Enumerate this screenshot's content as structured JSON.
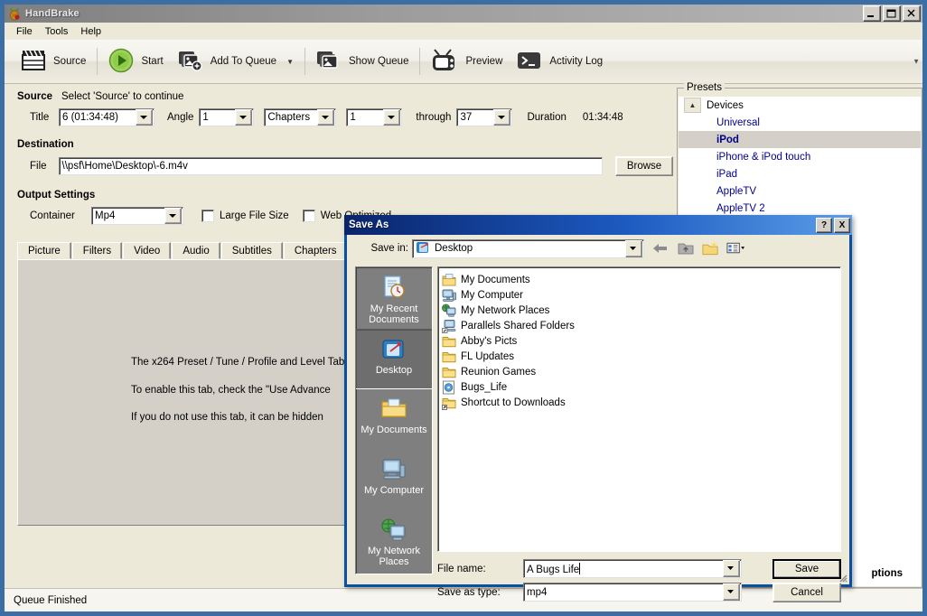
{
  "app": {
    "title": "HandBrake",
    "icon": "handbrake-pineapple-icon",
    "window_buttons": [
      "minimize",
      "maximize",
      "close"
    ]
  },
  "menu": {
    "items": [
      {
        "label": "File"
      },
      {
        "label": "Tools"
      },
      {
        "label": "Help"
      }
    ]
  },
  "toolbar": {
    "items": [
      {
        "label": "Source",
        "icon": "clapperboard-icon",
        "caret": false
      },
      {
        "label": "Start",
        "icon": "play-circle-icon",
        "caret": false
      },
      {
        "label": "Add To Queue",
        "icon": "add-to-queue-icon",
        "caret": true
      },
      {
        "label": "Show Queue",
        "icon": "queue-stack-icon",
        "caret": false
      },
      {
        "label": "Preview",
        "icon": "television-icon",
        "caret": false
      },
      {
        "label": "Activity Log",
        "icon": "terminal-icon",
        "caret": false
      }
    ],
    "overflow_icon": "chevron-down-icon"
  },
  "source": {
    "heading": "Source",
    "hint": "Select 'Source' to continue",
    "title_label": "Title",
    "title_value": "6 (01:34:48)",
    "angle_label": "Angle",
    "angle_value": "1",
    "range_type_value": "Chapters",
    "chapter_start_value": "1",
    "through_label": "through",
    "chapter_end_value": "37",
    "duration_label": "Duration",
    "duration_value": "01:34:48"
  },
  "destination": {
    "heading": "Destination",
    "file_label": "File",
    "file_value": "\\\\psf\\Home\\Desktop\\-6.m4v",
    "browse_label": "Browse"
  },
  "output_settings": {
    "heading": "Output Settings",
    "container_label": "Container",
    "container_value": "Mp4",
    "large_file_size_label": "Large File Size",
    "large_file_size_checked": false,
    "web_optimized_label": "Web Optimized",
    "web_optimized_checked": false
  },
  "tabs": [
    {
      "label": "Picture"
    },
    {
      "label": "Filters"
    },
    {
      "label": "Video"
    },
    {
      "label": "Audio"
    },
    {
      "label": "Subtitles"
    },
    {
      "label": "Chapters"
    }
  ],
  "tab_panel": {
    "line1": "The x264 Preset / Tune / Profile and Level Tab.",
    "line2": "To enable this tab, check the \"Use Advance",
    "line3": "If you do not use this tab, it can be hidden"
  },
  "presets": {
    "legend": "Presets",
    "group": {
      "label": "Devices",
      "expanded": true,
      "chevron": "chevron-up-icon"
    },
    "items": [
      {
        "label": "Universal",
        "selected": false
      },
      {
        "label": "iPod",
        "selected": true
      },
      {
        "label": "iPhone & iPod touch",
        "selected": false
      },
      {
        "label": "iPad",
        "selected": false
      },
      {
        "label": "AppleTV",
        "selected": false
      },
      {
        "label": "AppleTV 2",
        "selected": false
      }
    ],
    "options_button_label": "ptions"
  },
  "statusbar": {
    "text": "Queue Finished"
  },
  "save_dialog": {
    "title": "Save As",
    "help_button": "?",
    "close_button": "X",
    "save_in_label": "Save in:",
    "save_in_value": "Desktop",
    "save_in_icon": "desktop-icon",
    "nav_icons": [
      {
        "name": "back-arrow-icon"
      },
      {
        "name": "up-one-level-icon"
      },
      {
        "name": "new-folder-icon"
      },
      {
        "name": "views-icon"
      }
    ],
    "places": [
      {
        "label": "My Recent Documents",
        "icon": "recent-documents-icon",
        "selected": false
      },
      {
        "label": "Desktop",
        "icon": "desktop-icon",
        "selected": true
      },
      {
        "label": "My Documents",
        "icon": "my-documents-icon",
        "selected": false
      },
      {
        "label": "My Computer",
        "icon": "my-computer-icon",
        "selected": false
      },
      {
        "label": "My Network Places",
        "icon": "network-places-icon",
        "selected": false
      }
    ],
    "files": [
      {
        "label": "My Documents",
        "icon": "my-documents-icon"
      },
      {
        "label": "My Computer",
        "icon": "my-computer-icon"
      },
      {
        "label": "My Network Places",
        "icon": "network-places-icon"
      },
      {
        "label": "Parallels Shared Folders",
        "icon": "shared-folders-icon"
      },
      {
        "label": "Abby's Picts",
        "icon": "folder-icon"
      },
      {
        "label": "FL Updates",
        "icon": "folder-icon"
      },
      {
        "label": "Reunion Games",
        "icon": "folder-icon"
      },
      {
        "label": "Bugs_Life",
        "icon": "disc-image-icon"
      },
      {
        "label": "Shortcut to Downloads",
        "icon": "folder-shortcut-icon"
      }
    ],
    "file_name_label": "File name:",
    "file_name_value": "A Bugs Life",
    "save_as_type_label": "Save as type:",
    "save_as_type_value": "mp4",
    "save_button_label": "Save",
    "cancel_button_label": "Cancel"
  },
  "colors": {
    "desktop_blue": "#3a6ea5",
    "window_face": "#ece9d8",
    "dialog_title_blue": "#0a246a",
    "preset_link": "#00008b",
    "selection_gray": "#d4d0c8",
    "places_bar": "#7f7f7f",
    "start_green": "#7cc142"
  }
}
